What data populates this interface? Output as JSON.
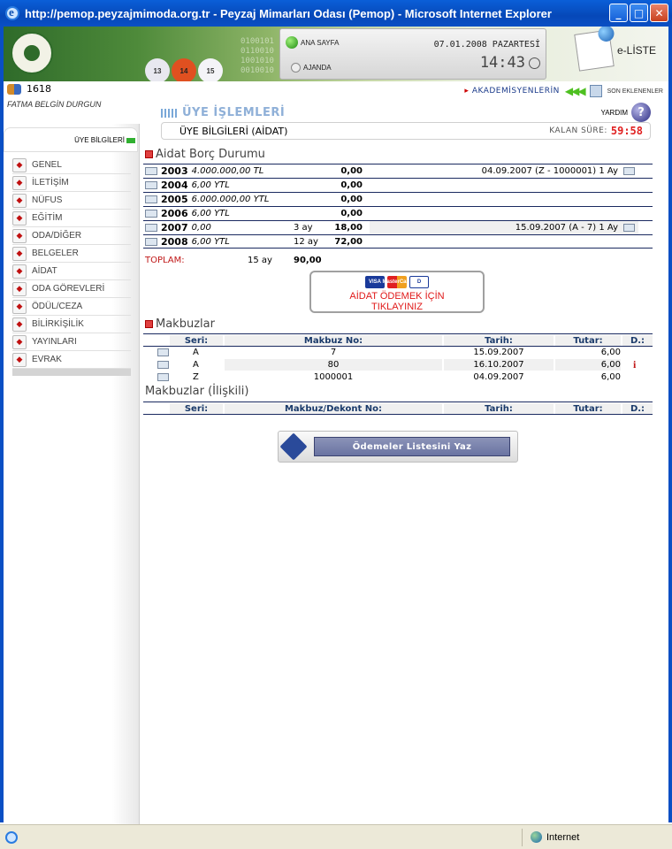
{
  "window": {
    "title": "http://pemop.peyzajmimoda.org.tr - Peyzaj Mimarları Odası (Pemop) - Microsoft Internet Explorer"
  },
  "header": {
    "ball_numbers": [
      "13",
      "14",
      "15"
    ],
    "binary_text": [
      "0100101",
      "0110010",
      "1001010",
      "0010010"
    ],
    "home_label": "ANA SAYFA",
    "agenda_label": "AJANDA",
    "date": "07.01.2008 PAZARTESİ",
    "time": "14:43",
    "eliste_label": "e-LİSTE"
  },
  "user": {
    "id": "1618",
    "name": "FATMA BELGİN DURGUN"
  },
  "topright": {
    "akademisyen_label": "AKADEMİSYENLERİN",
    "son_label": "SON EKLENENLER"
  },
  "sidebar": {
    "header": "ÜYE BİLGİLERİ",
    "items": [
      "GENEL",
      "İLETİŞİM",
      "NÜFUS",
      "EĞİTİM",
      "ODA/DİĞER",
      "BELGELER",
      "AİDAT",
      "ODA GÖREVLERİ",
      "ÖDÜL/CEZA",
      "BİLİRKİŞİLİK",
      "YAYINLARI",
      "EVRAK"
    ]
  },
  "main": {
    "section_title": "ÜYE İŞLEMLERİ",
    "help_label": "YARDIM",
    "page_title": "ÜYE BİLGİLERİ (AİDAT)",
    "remaining_label": "KALAN SÜRE:",
    "remaining_time": "59:58",
    "debt_title": "Aidat Borç Durumu",
    "debt_rows": [
      {
        "year": "2003",
        "amount": "4.000.000,00 TL",
        "months": "",
        "value": "0,00",
        "note": "04.09.2007 (Z - 1000001) 1 Ay"
      },
      {
        "year": "2004",
        "amount": "6,00 YTL",
        "months": "",
        "value": "0,00",
        "note": ""
      },
      {
        "year": "2005",
        "amount": "6.000.000,00 YTL",
        "months": "",
        "value": "0,00",
        "note": ""
      },
      {
        "year": "2006",
        "amount": "6,00 YTL",
        "months": "",
        "value": "0,00",
        "note": ""
      },
      {
        "year": "2007",
        "amount": "0,00",
        "months": "3 ay",
        "value": "18,00",
        "note": "15.09.2007 (A - 7) 1 Ay"
      },
      {
        "year": "2008",
        "amount": "6,00 YTL",
        "months": "12 ay",
        "value": "72,00",
        "note": ""
      }
    ],
    "total_label": "TOPLAM:",
    "total_months": "15 ay",
    "total_value": "90,00",
    "pay_button": {
      "line1": "AİDAT ÖDEMEK İÇİN",
      "line2": "TIKLAYINIZ",
      "cards": [
        "VISA",
        "MasterCard",
        "D"
      ]
    },
    "receipts_title": "Makbuzlar",
    "receipts_headers": [
      "Seri:",
      "Makbuz No:",
      "Tarih:",
      "Tutar:",
      "D.:"
    ],
    "receipts": [
      {
        "seri": "A",
        "no": "7",
        "tarih": "15.09.2007",
        "tutar": "6,00",
        "d": ""
      },
      {
        "seri": "A",
        "no": "80",
        "tarih": "16.10.2007",
        "tutar": "6,00",
        "d": "i"
      },
      {
        "seri": "Z",
        "no": "1000001",
        "tarih": "04.09.2007",
        "tutar": "6,00",
        "d": ""
      }
    ],
    "related_title": "Makbuzlar (İlişkili)",
    "related_headers": [
      "Seri:",
      "Makbuz/Dekont No:",
      "Tarih:",
      "Tutar:",
      "D.:"
    ],
    "print_button": "Ödemeler Listesini Yaz"
  },
  "statusbar": {
    "zone": "Internet"
  }
}
